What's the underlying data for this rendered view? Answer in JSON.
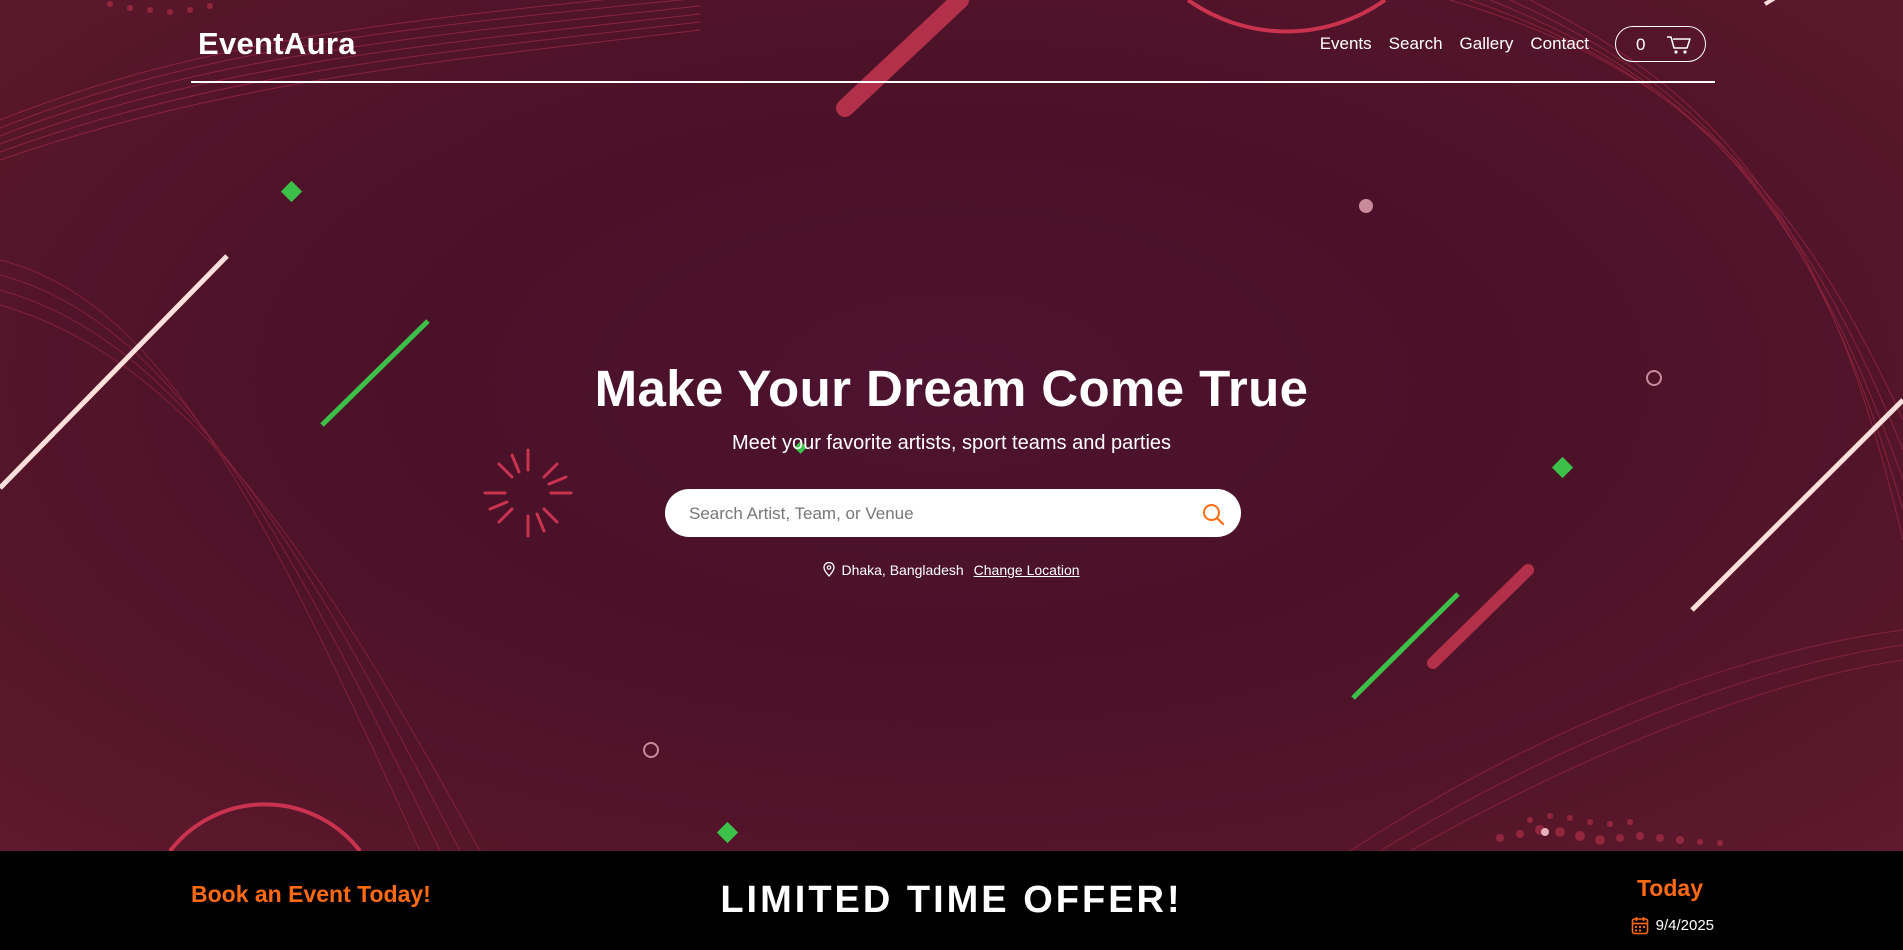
{
  "nav": {
    "brand": "EventAura",
    "links": [
      "Events",
      "Search",
      "Gallery",
      "Contact"
    ],
    "cart_count": "0",
    "cart_icon": "cart-icon"
  },
  "hero": {
    "headline": "Make Your Dream Come True",
    "subline": "Meet your favorite artists, sport teams and parties",
    "search_placeholder": "Search Artist, Team, or Venue",
    "search_value": "",
    "location": "Dhaka, Bangladesh",
    "change_location": "Change Location"
  },
  "offer": {
    "book": "Book an Event Today!",
    "limited": "LIMITED TIME OFFER!",
    "today_label": "Today",
    "date": "9/4/2025"
  },
  "colors": {
    "accent": "#ff6a12",
    "background": "#4a1228",
    "green": "#3cc04a",
    "bar": "#000000"
  }
}
